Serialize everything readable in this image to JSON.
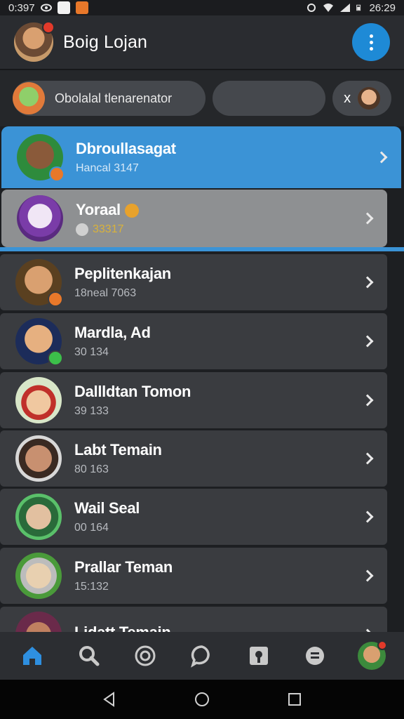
{
  "status_bar": {
    "time_left": "0:397",
    "time_right": "26:29"
  },
  "header": {
    "title": "Boig Lojan"
  },
  "filters": {
    "search_chip": "Obolalal tlenarenator",
    "close_chip": "x"
  },
  "list": [
    {
      "name": "Dbroullasagat",
      "sub": "Hancal 3147",
      "state": "active"
    },
    {
      "name": "Yoraal",
      "sub": "33317",
      "state": "hover"
    },
    {
      "name": "Peplitenkajan",
      "sub": "18neal 7063",
      "state": "normal"
    },
    {
      "name": "Mardla, Ad",
      "sub": "30 134",
      "state": "normal"
    },
    {
      "name": "Dallldtan Tomon",
      "sub": "39 133",
      "state": "normal"
    },
    {
      "name": "Labt Temain",
      "sub": "80 163",
      "state": "normal"
    },
    {
      "name": "Wail Seal",
      "sub": "00 164",
      "state": "normal"
    },
    {
      "name": "Prallar Teman",
      "sub": "15:132",
      "state": "normal"
    },
    {
      "name": "Lidatt Temain",
      "sub": "",
      "state": "normal"
    }
  ],
  "bottom_nav": [
    "home-icon",
    "search-icon",
    "activity-icon",
    "chat-icon",
    "badge-icon",
    "list-icon",
    "profile-avatar"
  ],
  "colors": {
    "accent": "#1e8ad6",
    "active_row": "#3b93d6",
    "background": "#1d1f22"
  }
}
